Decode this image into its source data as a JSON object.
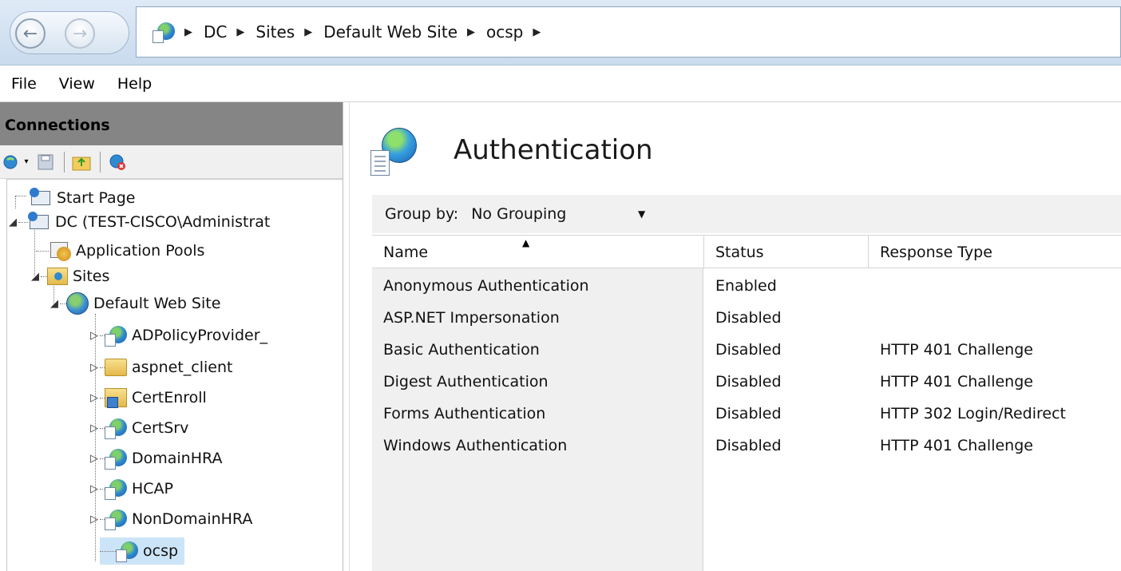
{
  "address_bar": {
    "crumbs": [
      "DC",
      "Sites",
      "Default Web Site",
      "ocsp"
    ],
    "icon": "iis-globe-icon"
  },
  "menu": {
    "items": [
      "File",
      "View",
      "Help"
    ]
  },
  "connections": {
    "title": "Connections",
    "toolbar_icons": [
      "connect-icon",
      "save-icon",
      "up-folder-icon",
      "disconnect-icon"
    ],
    "tree": [
      {
        "label": "Start Page",
        "icon": "start-page-icon"
      },
      {
        "label": "DC (TEST-CISCO\\Administrat",
        "icon": "server-icon"
      },
      {
        "label": "Application Pools",
        "icon": "app-pools-icon"
      },
      {
        "label": "Sites",
        "icon": "sites-folder-icon"
      },
      {
        "label": "Default Web Site",
        "icon": "website-globe-icon"
      },
      {
        "label": "ADPolicyProvider_",
        "icon": "app-globe-icon"
      },
      {
        "label": "aspnet_client",
        "icon": "folder-icon"
      },
      {
        "label": "CertEnroll",
        "icon": "virtual-dir-icon"
      },
      {
        "label": "CertSrv",
        "icon": "app-globe-icon"
      },
      {
        "label": "DomainHRA",
        "icon": "app-globe-icon"
      },
      {
        "label": "HCAP",
        "icon": "app-globe-icon"
      },
      {
        "label": "NonDomainHRA",
        "icon": "app-globe-icon"
      },
      {
        "label": "ocsp",
        "icon": "app-globe-icon"
      }
    ]
  },
  "main": {
    "title": "Authentication",
    "feature_icon": "authentication-globe-icon",
    "group_by": {
      "label": "Group by:",
      "value": "No Grouping"
    },
    "columns": [
      "Name",
      "Status",
      "Response Type"
    ],
    "rows": [
      {
        "name": "Anonymous Authentication",
        "status": "Enabled",
        "response": ""
      },
      {
        "name": "ASP.NET Impersonation",
        "status": "Disabled",
        "response": ""
      },
      {
        "name": "Basic Authentication",
        "status": "Disabled",
        "response": "HTTP 401 Challenge"
      },
      {
        "name": "Digest Authentication",
        "status": "Disabled",
        "response": "HTTP 401 Challenge"
      },
      {
        "name": "Forms Authentication",
        "status": "Disabled",
        "response": "HTTP 302 Login/Redirect"
      },
      {
        "name": "Windows Authentication",
        "status": "Disabled",
        "response": "HTTP 401 Challenge"
      }
    ]
  }
}
